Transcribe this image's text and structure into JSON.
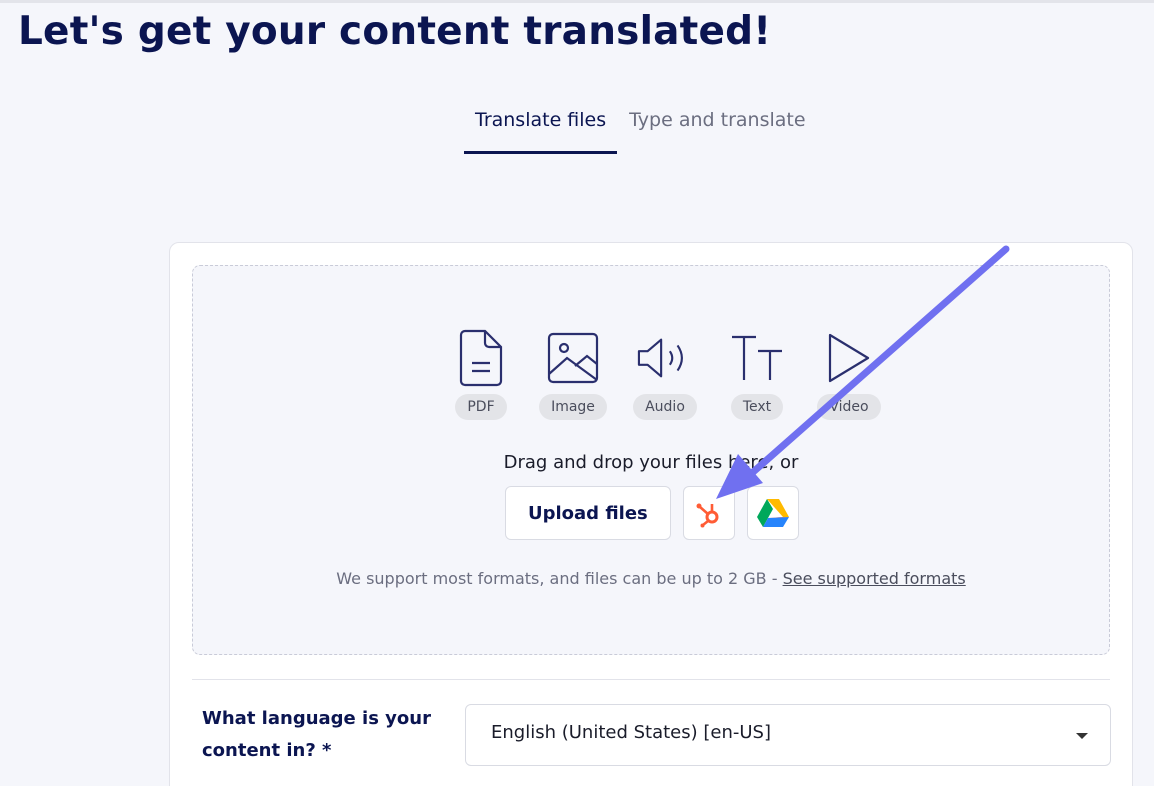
{
  "page_title": "Let's get your content translated!",
  "tabs": [
    {
      "label": "Translate files",
      "active": true
    },
    {
      "label": "Type and translate",
      "active": false
    }
  ],
  "file_types": [
    {
      "label": "PDF",
      "icon": "pdf-file-icon"
    },
    {
      "label": "Image",
      "icon": "image-icon"
    },
    {
      "label": "Audio",
      "icon": "speaker-icon"
    },
    {
      "label": "Text",
      "icon": "text-icon"
    },
    {
      "label": "Video",
      "icon": "play-icon"
    }
  ],
  "upload": {
    "drag_text": "Drag and drop your files here, or",
    "upload_label": "Upload files",
    "hubspot_icon": "hubspot-icon",
    "drive_icon": "google-drive-icon",
    "support_text": "We support most formats, and files can be up to 2 GB - ",
    "support_link": "See supported formats"
  },
  "language": {
    "label": "What language is your content in? *",
    "value": "English (United States) [en-US]"
  },
  "colors": {
    "navy": "#0b1551",
    "arrow": "#7070f0",
    "hubspot": "#ff5c35"
  }
}
